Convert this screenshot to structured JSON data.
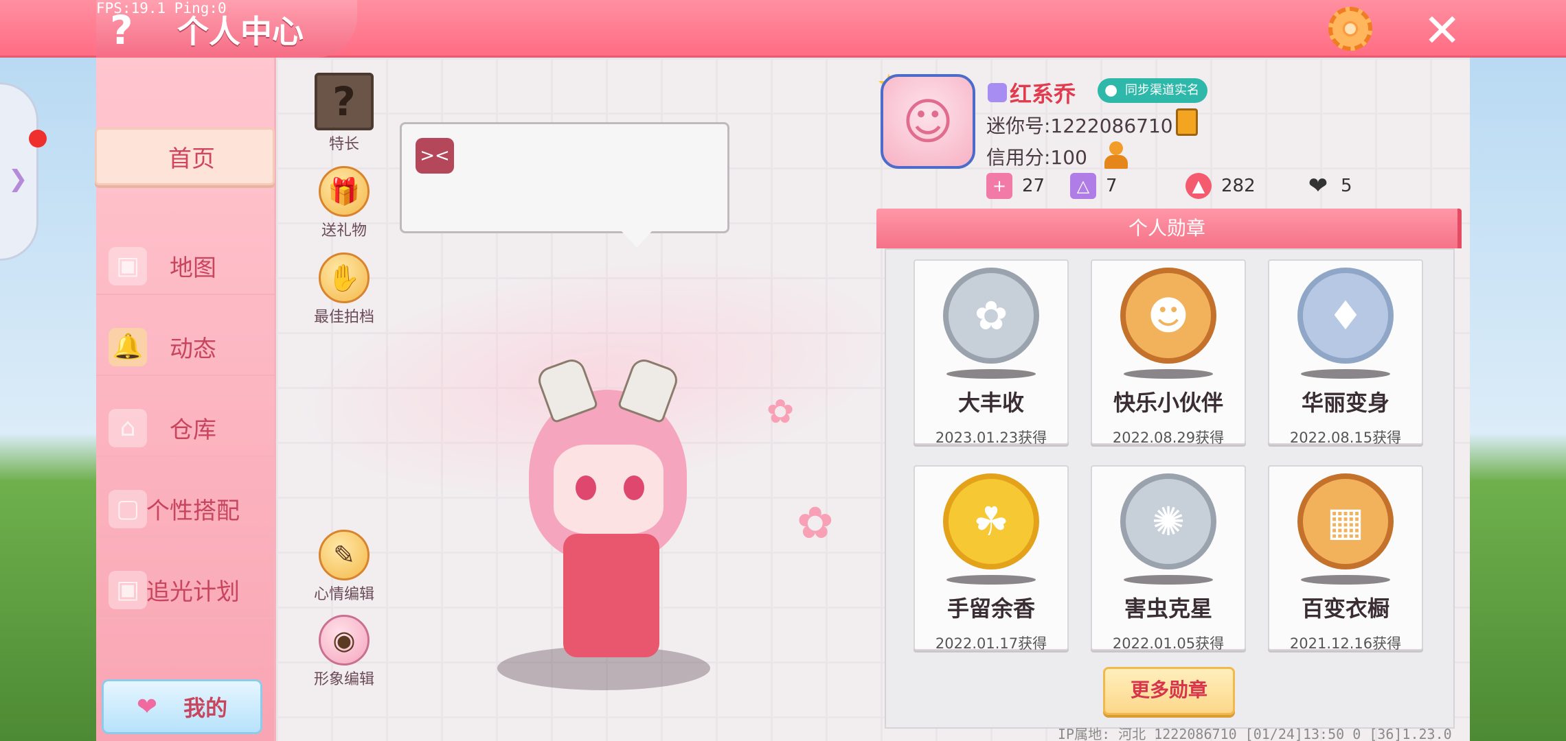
{
  "hud": {
    "fps_text": "FPS:19.1  Ping:0"
  },
  "header": {
    "title": "个人中心",
    "help_icon": "question-icon",
    "settings_icon": "gear-icon",
    "close_icon": "close-icon"
  },
  "sidebar": {
    "items": [
      {
        "label": "首页",
        "active": true
      },
      {
        "label": "地图"
      },
      {
        "label": "动态"
      },
      {
        "label": "仓库"
      },
      {
        "label": "个性搭配"
      },
      {
        "label": "追光计划"
      }
    ],
    "my_button": "我的"
  },
  "actions": {
    "talent": "特长",
    "gift": "送礼物",
    "partner": "最佳拍档",
    "mood": "心情编辑",
    "appearance": "形象编辑"
  },
  "profile": {
    "name": "红系乔",
    "sync_badge": "同步渠道实名",
    "mini_id": "迷你号:1222086710",
    "credit": "信用分:100",
    "stats": [
      {
        "icon": "plus-icon",
        "value": "27"
      },
      {
        "icon": "cheer-icon",
        "value": "7"
      },
      {
        "icon": "fire-icon",
        "value": "282"
      },
      {
        "icon": "heart-icon",
        "value": "5"
      }
    ]
  },
  "medals": {
    "header": "个人勋章",
    "items": [
      {
        "name": "大丰收",
        "date": "2023.01.23获得",
        "style": "silver"
      },
      {
        "name": "快乐小伙伴",
        "date": "2022.08.29获得",
        "style": "bronze"
      },
      {
        "name": "华丽变身",
        "date": "2022.08.15获得",
        "style": "blue"
      },
      {
        "name": "手留余香",
        "date": "2022.01.17获得",
        "style": "gold"
      },
      {
        "name": "害虫克星",
        "date": "2022.01.05获得",
        "style": "silver"
      },
      {
        "name": "百变衣橱",
        "date": "2021.12.16获得",
        "style": "bronze"
      }
    ],
    "more_button": "更多勋章"
  },
  "footer": {
    "text": "IP属地: 河北   1222086710   [01/24]13:50 0  [36]1.23.0"
  }
}
